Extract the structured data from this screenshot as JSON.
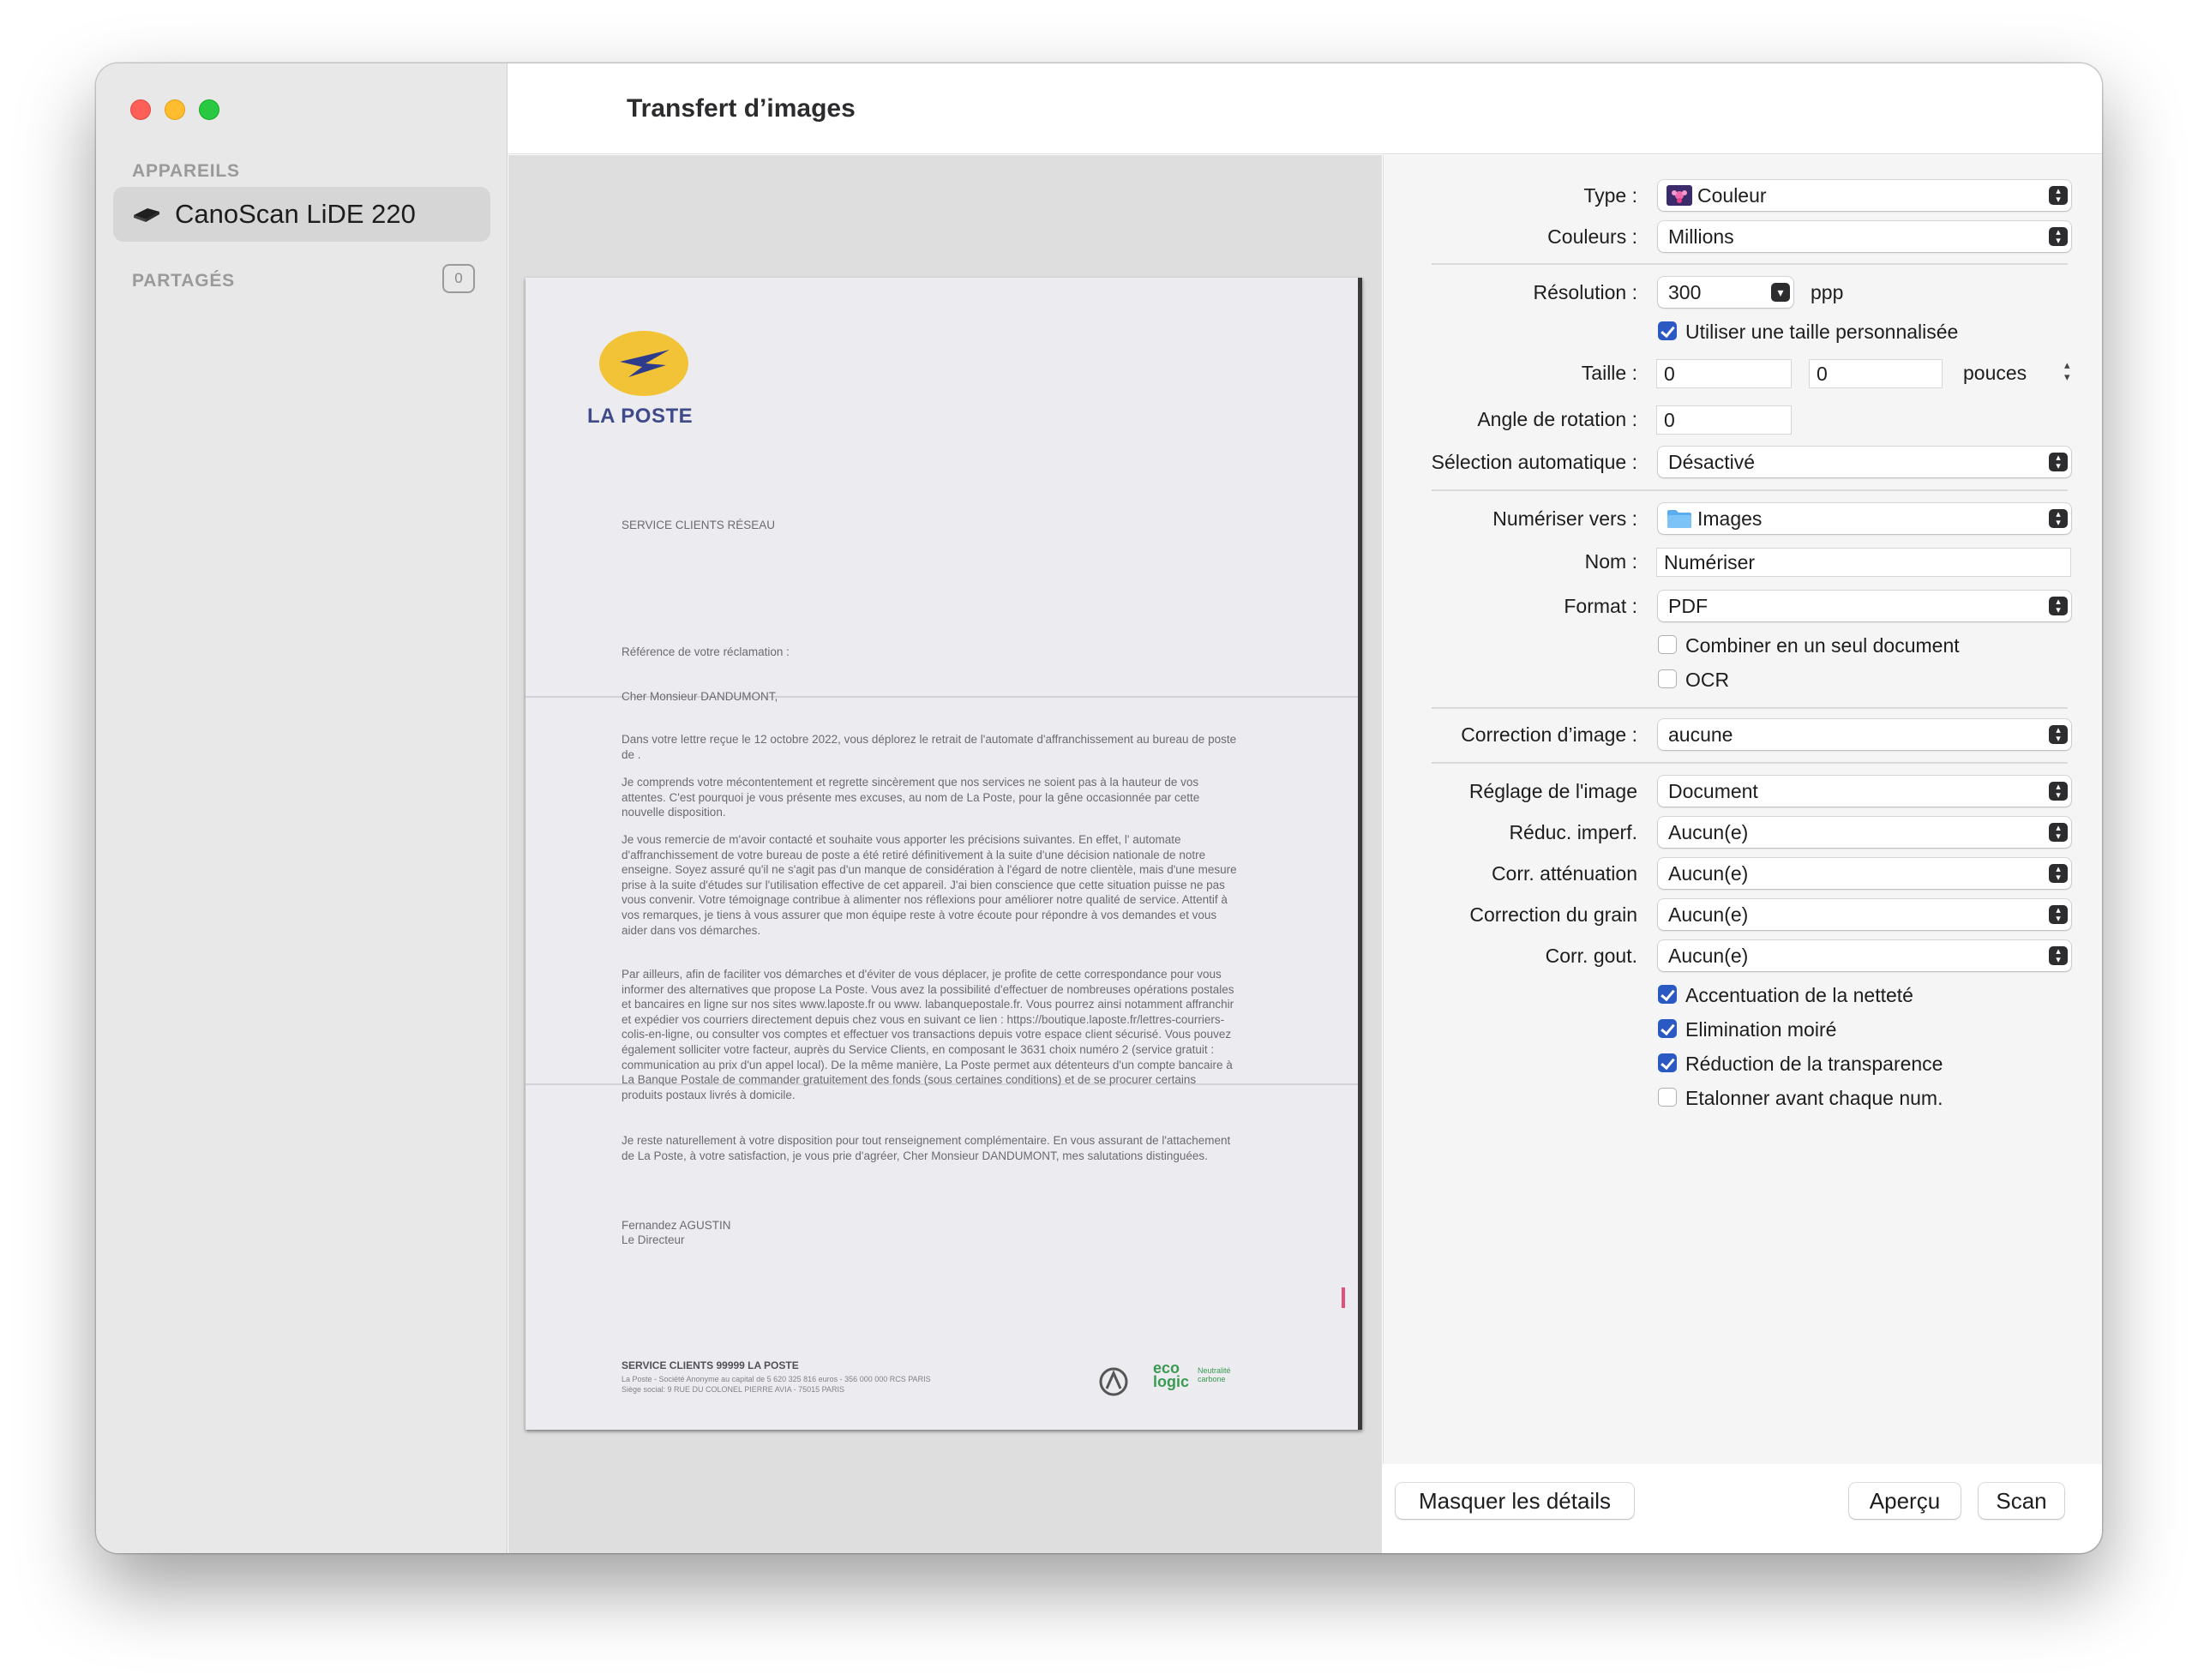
{
  "window": {
    "title": "Transfert d’images"
  },
  "sidebar": {
    "devices_header": "APPAREILS",
    "device_name": "CanoScan LiDE 220",
    "shared_header": "PARTAGÉS",
    "shared_count": "0"
  },
  "document": {
    "logo_text": "LA POSTE",
    "dept": "SERVICE CLIENTS RÉSEAU",
    "reference": "Référence de votre réclamation :",
    "salutation": "Cher Monsieur DANDUMONT,",
    "paragraphs": [
      "Dans votre lettre reçue le 12 octobre 2022, vous déplorez le retrait de l'automate d'affranchissement au bureau de poste de .",
      "Je comprends votre mécontentement et regrette sincèrement que nos services ne soient pas à la hauteur de vos attentes. C'est pourquoi je vous présente mes excuses, au nom de La Poste, pour la gêne occasionnée par cette nouvelle disposition.",
      "Je vous remercie de m'avoir contacté et souhaite vous apporter les précisions suivantes. En effet, l' automate d'affranchissement de votre bureau de poste a été retiré définitivement à la suite d'une décision nationale de notre enseigne. Soyez assuré qu'il ne s'agit pas d'un manque de considération à l'égard de notre clientèle, mais d'une mesure prise à la suite d'études sur l'utilisation effective de cet appareil. J'ai bien conscience que cette situation puisse ne pas vous convenir. Votre témoignage contribue à alimenter nos réflexions pour améliorer notre qualité de service. Attentif à vos remarques, je tiens à vous assurer que mon équipe reste à votre écoute pour répondre à vos demandes et vous aider dans vos démarches.",
      "Par ailleurs, afin de faciliter vos démarches et d'éviter de vous déplacer, je profite de cette correspondance pour vous informer des alternatives que propose La Poste. Vous avez la possibilité d'effectuer de nombreuses opérations postales et bancaires en ligne sur nos sites www.laposte.fr ou www. labanquepostale.fr. Vous pourrez ainsi notamment affranchir et expédier vos courriers directement depuis chez vous en suivant ce lien : https://boutique.laposte.fr/lettres-courriers-colis-en-ligne, ou consulter vos comptes et effectuer vos transactions depuis votre espace client sécurisé. Vous pouvez également solliciter votre facteur, auprès du Service Clients, en composant le 3631 choix numéro 2 (service gratuit : communication au prix d'un appel local). De la même manière, La Poste permet aux détenteurs d'un compte bancaire à La Banque Postale de commander gratuitement des fonds (sous certaines conditions) et de se procurer certains produits postaux livrés à domicile.",
      "Je reste naturellement à votre disposition pour tout renseignement complémentaire. En vous assurant de l'attachement de La Poste, à votre satisfaction, je vous prie d'agréer, Cher Monsieur DANDUMONT, mes salutations distinguées."
    ],
    "signer_name": "Fernandez AGUSTIN",
    "signer_title": "Le Directeur",
    "footer_title": "SERVICE CLIENTS 99999 LA POSTE",
    "footer_line1": "La Poste - Société Anonyme au capital de 5 620 325 816 euros - 356 000 000 RCS PARIS",
    "footer_line2": "Siège social: 9 RUE DU COLONEL PIERRE AVIA - 75015 PARIS",
    "eco_text": "eco logic",
    "eco_sub": "Neutralité carbone"
  },
  "settings": {
    "type_label": "Type :",
    "type_value": "Couleur",
    "colors_label": "Couleurs :",
    "colors_value": "Millions",
    "resolution_label": "Résolution :",
    "resolution_value": "300",
    "resolution_unit": "ppp",
    "custom_size_label": "Utiliser une taille personnalisée",
    "custom_size_checked": true,
    "size_label": "Taille :",
    "size_width": "0",
    "size_height": "0",
    "size_unit": "pouces",
    "rotation_label": "Angle de rotation :",
    "rotation_value": "0",
    "auto_select_label": "Sélection automatique :",
    "auto_select_value": "Désactivé",
    "scan_to_label": "Numériser vers :",
    "scan_to_value": "Images",
    "name_label": "Nom :",
    "name_value": "Numériser",
    "format_label": "Format :",
    "format_value": "PDF",
    "combine_label": "Combiner en un seul document",
    "combine_checked": false,
    "ocr_label": "OCR",
    "ocr_checked": false,
    "image_correction_label": "Correction d’image :",
    "image_correction_value": "aucune",
    "image_setting_label": "Réglage de l'image",
    "image_setting_value": "Document",
    "reduc_label": "Réduc. imperf.",
    "reduc_value": "Aucun(e)",
    "atten_label": "Corr. atténuation",
    "atten_value": "Aucun(e)",
    "grain_label": "Correction du grain",
    "grain_value": "Aucun(e)",
    "gout_label": "Corr. gout.",
    "gout_value": "Aucun(e)",
    "sharpen_label": "Accentuation de la netteté",
    "sharpen_checked": true,
    "moire_label": "Elimination moiré",
    "moire_checked": true,
    "transparency_label": "Réduction de la transparence",
    "transparency_checked": true,
    "calibrate_label": "Etalonner avant chaque num.",
    "calibrate_checked": false
  },
  "buttons": {
    "hide_details": "Masquer les détails",
    "preview": "Aperçu",
    "scan": "Scan"
  },
  "colors": {
    "checkbox_accent": "#2b59c3",
    "close": "#fe5f57",
    "minimize": "#febc2e",
    "maximize": "#28c840",
    "logo_yellow": "#f2c337",
    "logo_blue": "#2e3a8c"
  },
  "icons": {
    "scanner": "scanner-icon",
    "type": "color-flower-icon",
    "folder": "folder-icon",
    "popup": "chevron-updown-icon"
  }
}
